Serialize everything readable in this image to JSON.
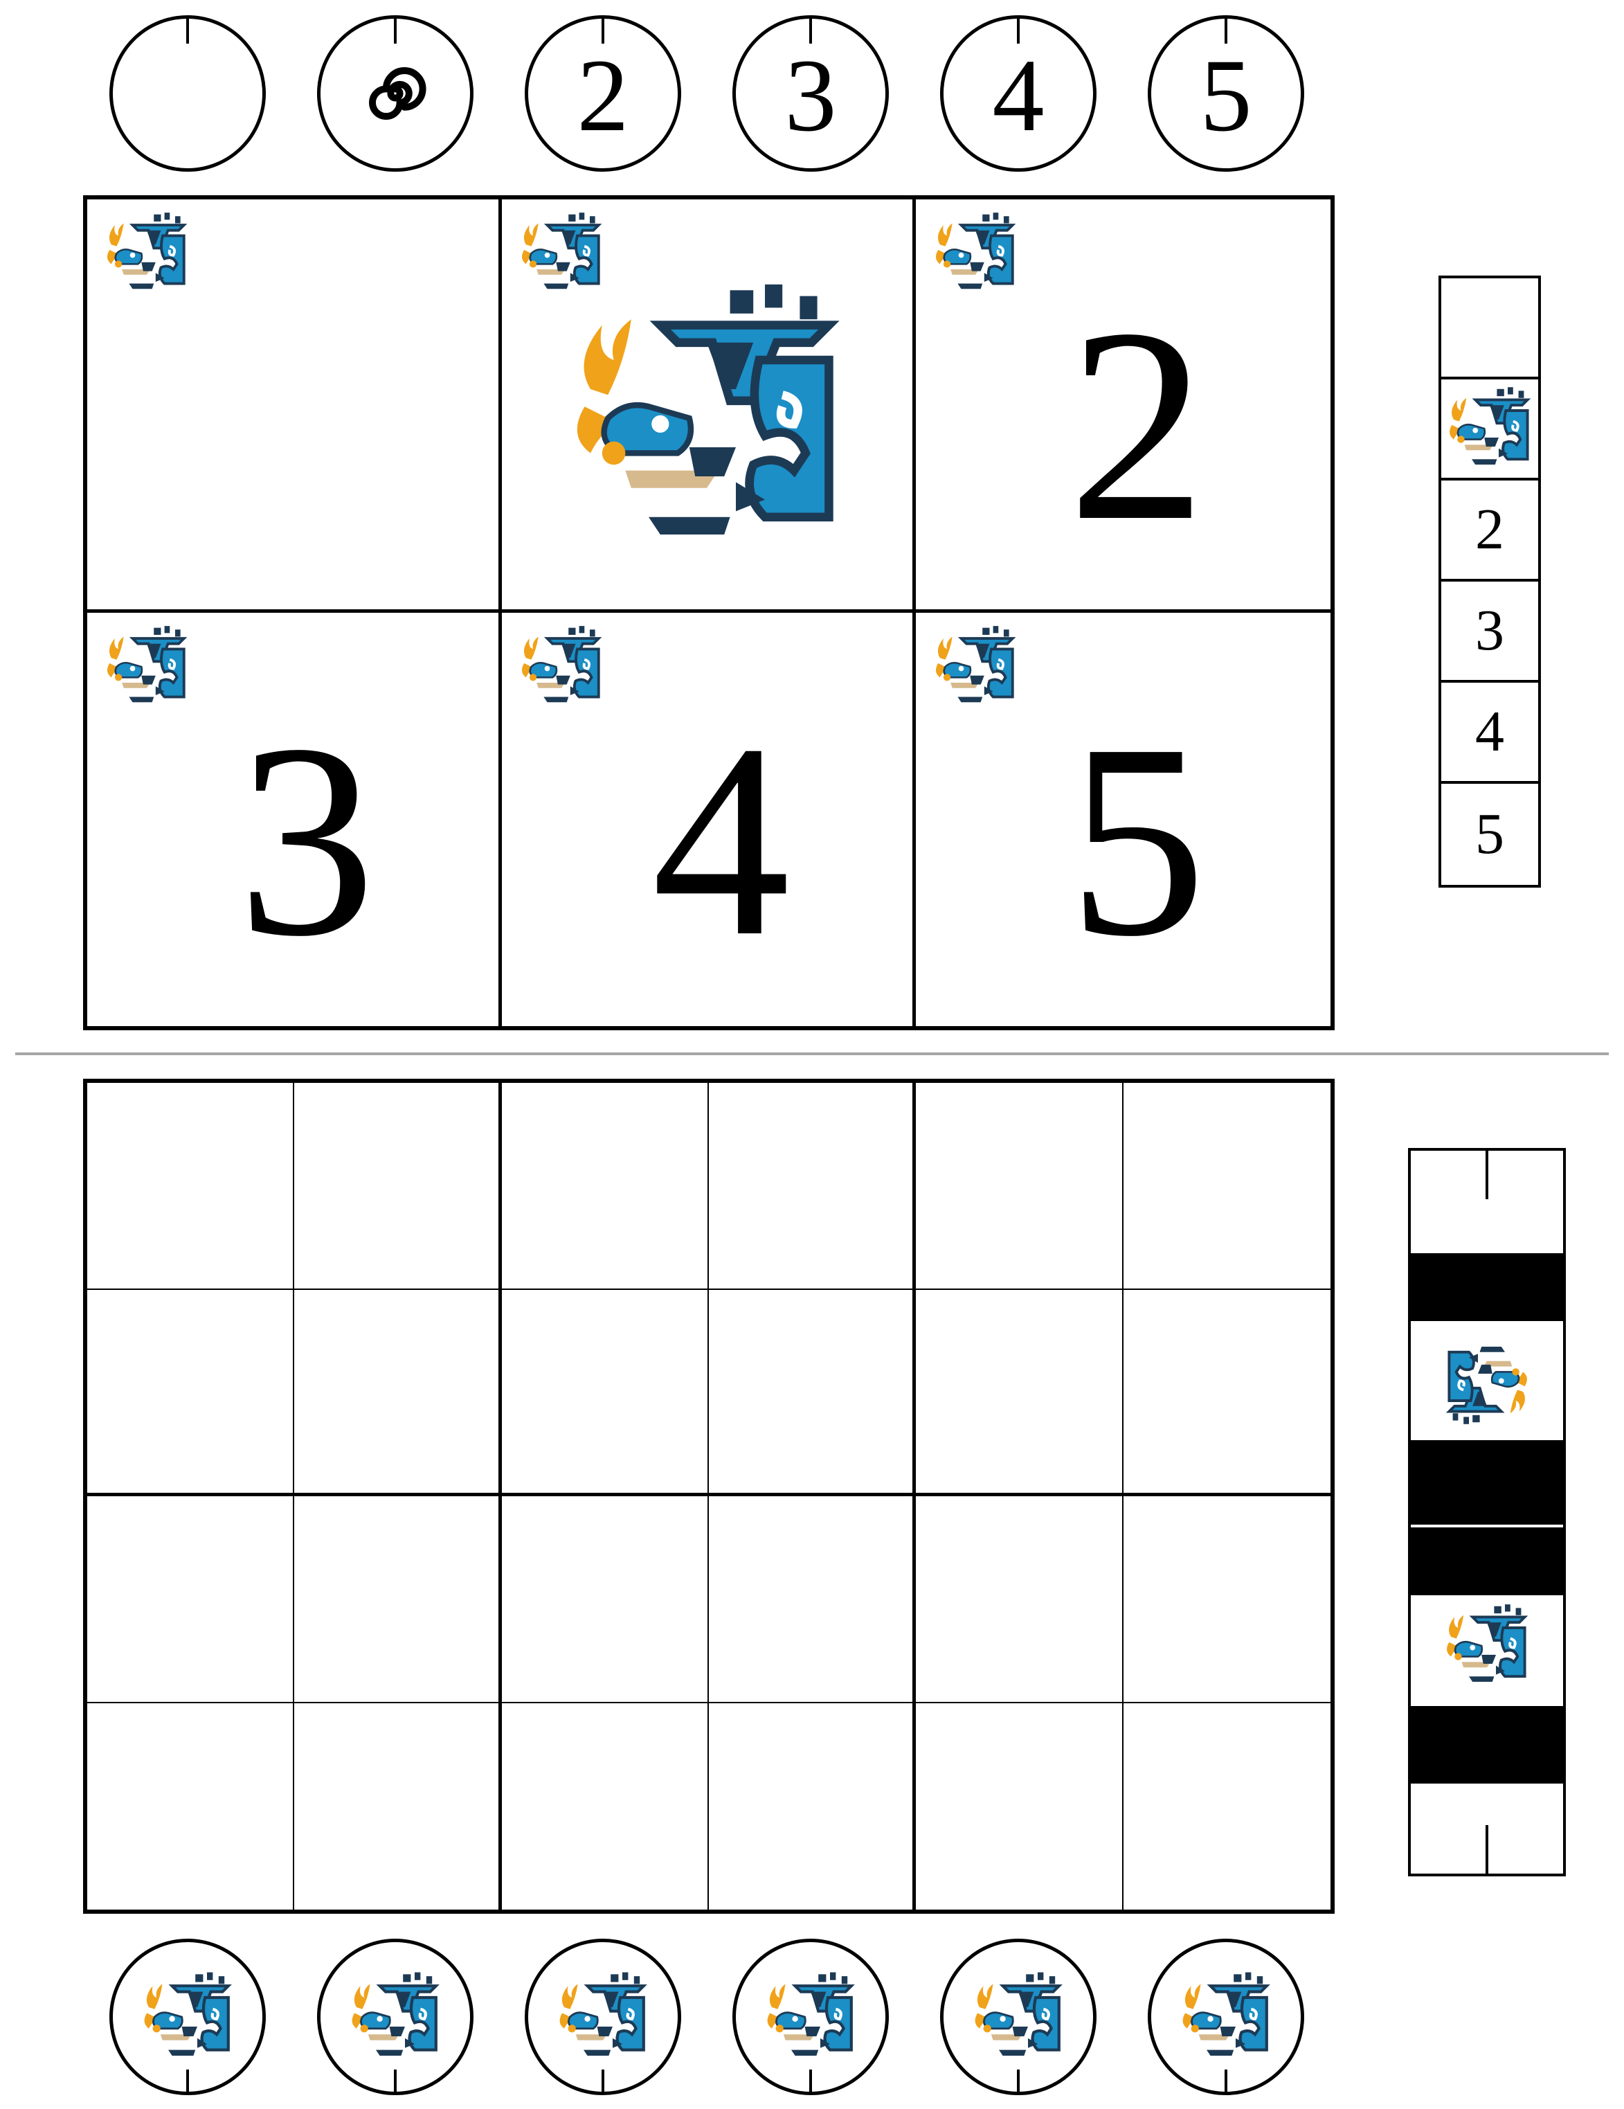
{
  "top_tokens": [
    {
      "kind": "blank",
      "label": ""
    },
    {
      "kind": "swirl",
      "label": ""
    },
    {
      "kind": "number",
      "label": "2"
    },
    {
      "kind": "number",
      "label": "3"
    },
    {
      "kind": "number",
      "label": "4"
    },
    {
      "kind": "number",
      "label": "5"
    }
  ],
  "big_grid": {
    "cells": [
      {
        "kind": "blank",
        "label": ""
      },
      {
        "kind": "monster-icon",
        "label": ""
      },
      {
        "kind": "number",
        "label": "2"
      },
      {
        "kind": "number",
        "label": "3"
      },
      {
        "kind": "number",
        "label": "4"
      },
      {
        "kind": "number",
        "label": "5"
      }
    ]
  },
  "side_strip": {
    "cells": [
      {
        "kind": "blank",
        "label": ""
      },
      {
        "kind": "monster-icon",
        "label": ""
      },
      {
        "kind": "number",
        "label": "2"
      },
      {
        "kind": "number",
        "label": "3"
      },
      {
        "kind": "number",
        "label": "4"
      },
      {
        "kind": "number",
        "label": "5"
      }
    ]
  },
  "lower_grid": {
    "columns": 6,
    "rows": 4
  },
  "bottom_tokens": {
    "count": 6,
    "icon": "monster-icon"
  },
  "colors": {
    "ink": "#000000",
    "divider": "#a6a6a6",
    "icon_blue": "#1b8fc6",
    "icon_dark": "#1d3a55",
    "icon_orange": "#f0a21a",
    "icon_tan": "#d6b98c"
  }
}
